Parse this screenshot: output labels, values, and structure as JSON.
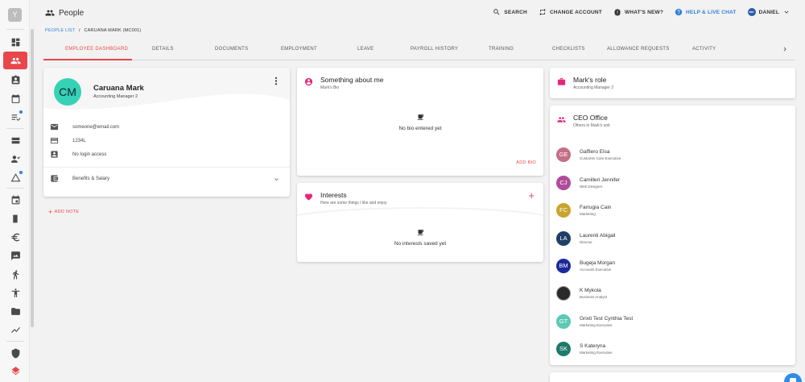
{
  "sidebar": {
    "logo_letter": "Y",
    "items": [
      {
        "icon": "dashboard-icon"
      },
      {
        "icon": "people-icon",
        "active": true
      },
      {
        "icon": "contact-card-icon"
      },
      {
        "icon": "calendar-icon"
      },
      {
        "icon": "checklist-icon",
        "dot": true
      },
      {
        "icon": "inbox-icon"
      },
      {
        "icon": "recruit-icon"
      },
      {
        "icon": "warning-icon",
        "dot": true
      },
      {
        "icon": "event-icon"
      },
      {
        "icon": "door-icon"
      },
      {
        "icon": "euro-icon"
      },
      {
        "icon": "feedback-icon"
      },
      {
        "icon": "run-icon"
      },
      {
        "icon": "accessibility-icon"
      },
      {
        "icon": "folder-icon"
      },
      {
        "icon": "trend-icon"
      },
      {
        "icon": "shield-icon"
      },
      {
        "icon": "layers-icon"
      }
    ]
  },
  "header": {
    "title": "People",
    "actions": {
      "search": "SEARCH",
      "change_account": "CHANGE ACCOUNT",
      "whats_new": "WHAT'S NEW?",
      "help": "HELP & LIVE CHAT",
      "user_initials": "dm",
      "user": "DANIEL"
    }
  },
  "breadcrumb": {
    "link": "PEOPLE LIST",
    "separator": "/",
    "current": "CARUANA MARK (MC001)"
  },
  "tabs": [
    {
      "label": "EMPLOYEE DASHBOARD",
      "active": true
    },
    {
      "label": "DETAILS"
    },
    {
      "label": "DOCUMENTS"
    },
    {
      "label": "EMPLOYMENT"
    },
    {
      "label": "LEAVE"
    },
    {
      "label": "PAYROLL HISTORY"
    },
    {
      "label": "TRAINING"
    },
    {
      "label": "CHECKLISTS"
    },
    {
      "label": "ALLOWANCE REQUESTS"
    },
    {
      "label": "ACTIVITY"
    }
  ],
  "profile": {
    "initials": "CM",
    "name": "Caruana Mark",
    "role": "Accounting Manager 2",
    "email": "someone@email.com",
    "id_number": "1234L",
    "login": "No login access",
    "benefits": "Benefits & Salary",
    "avatar_color": "#36d2b5"
  },
  "add_note": "ADD NOTE",
  "about": {
    "title": "Something about me",
    "subtitle": "Mark's Bio",
    "empty_text": "No bio entered yet",
    "action": "ADD BIO"
  },
  "interests": {
    "title": "Interests",
    "subtitle": "Here are some things I like and enjoy",
    "empty_text": "No interests saved yet",
    "add_symbol": "+"
  },
  "role_card": {
    "title": "Mark's role",
    "subtitle": "Accounting Manager 2"
  },
  "unit": {
    "title": "CEO Office",
    "subtitle": "Others in Mark's unit",
    "members": [
      {
        "initials": "GE",
        "name": "Gaffiero Elsa",
        "title": "Customer Care Executive",
        "color": "#c46f83"
      },
      {
        "initials": "CJ",
        "name": "Camilleri Jennifer",
        "title": "Web Designer",
        "color": "#b14b9a"
      },
      {
        "initials": "FC",
        "name": "Farrugia Cain",
        "title": "Marketing",
        "color": "#c9a42c"
      },
      {
        "initials": "LA",
        "name": "Laurenti Abigail",
        "title": "Director",
        "color": "#1f3f66"
      },
      {
        "initials": "BM",
        "name": "Bugeja Morgan",
        "title": "Accounts Executive",
        "color": "#1c2a9c"
      },
      {
        "initials": "",
        "name": "K Mykola",
        "title": "Business Analyst",
        "color": "#2a2a2a"
      },
      {
        "initials": "GT",
        "name": "Grixti Test Cynthia Test",
        "title": "Marketing Executive",
        "color": "#5cc9b5"
      },
      {
        "initials": "SK",
        "name": "S Kateryna",
        "title": "Marketing Executive",
        "color": "#1f7a6a"
      }
    ]
  },
  "colors": {
    "accent": "#e8464b",
    "link": "#2f7fd8",
    "pink_icon": "#e8257a"
  }
}
